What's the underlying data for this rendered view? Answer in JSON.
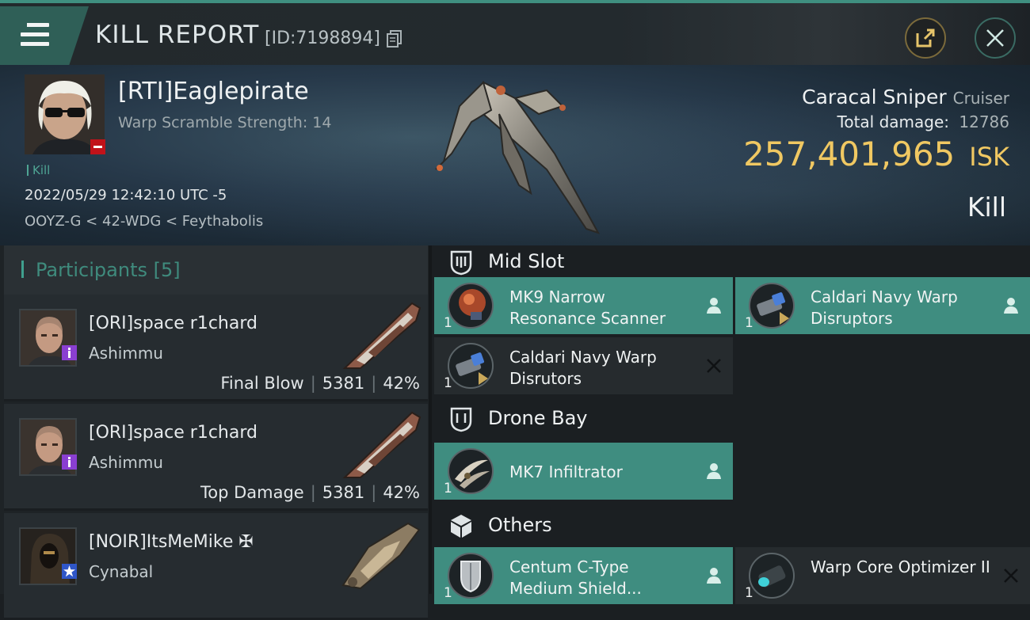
{
  "header": {
    "title": "KILL REPORT",
    "report_id": "[ID:7198894]"
  },
  "victim": {
    "name": "[RTI]Eaglepirate",
    "subtitle": "Warp Scramble Strength: 14",
    "kill_tag": "Kill",
    "timestamp": "2022/05/29 12:42:10 UTC -5",
    "location": "OOYZ-G < 42-WDG < Feythabolis",
    "ship_name": "Caracal Sniper",
    "ship_class": "Cruiser",
    "total_damage_label": "Total damage:",
    "total_damage": "12786",
    "isk_value": "257,401,965",
    "isk_unit": "ISK",
    "result": "Kill"
  },
  "participants": {
    "label": "Participants [5]",
    "rows": [
      {
        "name": "[ORI]space r1chard",
        "ship": "Ashimmu",
        "role": "Final Blow",
        "damage": "5381",
        "percent": "42%",
        "badge": "purple"
      },
      {
        "name": "[ORI]space r1chard",
        "ship": "Ashimmu",
        "role": "Top Damage",
        "damage": "5381",
        "percent": "42%",
        "badge": "purple"
      },
      {
        "name": "[NOIR]ItsMeMike ✠",
        "ship": "Cynabal",
        "role": "",
        "damage": "",
        "percent": "",
        "badge": "blue-star"
      }
    ]
  },
  "slots": {
    "mid": {
      "label": "Mid Slot",
      "items": [
        {
          "name": "MK9 Narrow Resonance Scanner",
          "qty": "1",
          "state": "dropped"
        },
        {
          "name": "Caldari Navy Warp Disruptors",
          "qty": "1",
          "state": "dropped"
        },
        {
          "name": "Caldari Navy Warp Disrutors",
          "qty": "1",
          "state": "destroyed"
        }
      ]
    },
    "drone": {
      "label": "Drone Bay",
      "items": [
        {
          "name": "MK7  Infiltrator",
          "qty": "1",
          "state": "dropped"
        }
      ]
    },
    "others": {
      "label": "Others",
      "items": [
        {
          "name": "Centum C-Type Medium Shield...",
          "qty": "1",
          "state": "dropped"
        },
        {
          "name": "Warp Core Optimizer II",
          "qty": "1",
          "state": "destroyed"
        }
      ]
    }
  },
  "colors": {
    "accent_teal": "#3f8d80",
    "isk_gold": "#f0c862",
    "badge_red": "#c1121a",
    "badge_purple": "#8a3fd1"
  }
}
